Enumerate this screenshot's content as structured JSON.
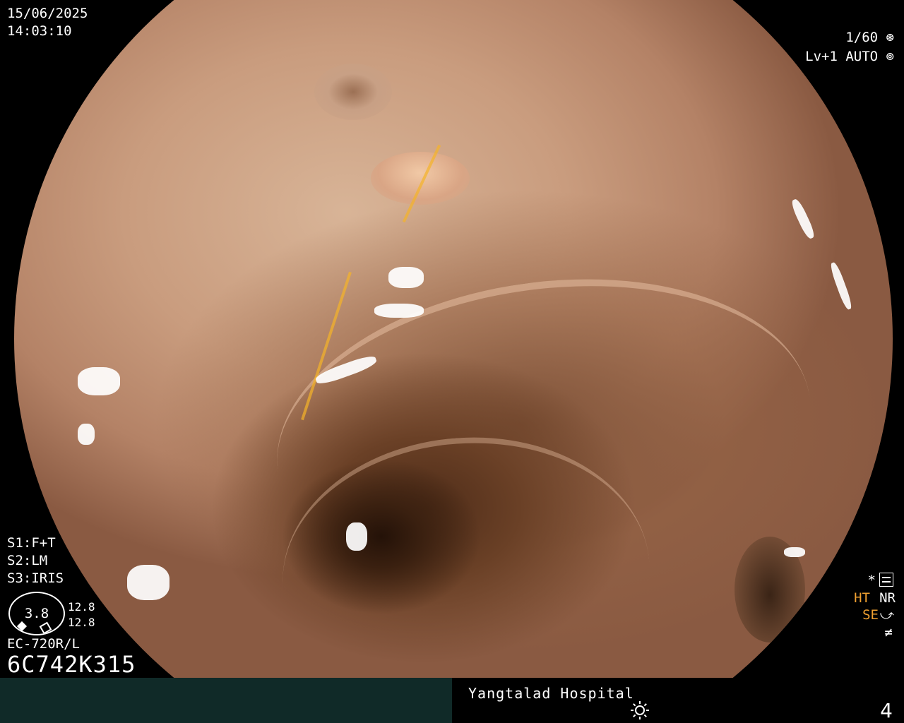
{
  "header": {
    "date": "15/06/2025",
    "time": "14:03:10"
  },
  "camera": {
    "shutter": "1/60",
    "exposure": "Lv+1 AUTO",
    "shutter_icon": "aperture-icon",
    "auto_icon": "auto-iris-icon"
  },
  "settings_list": [
    {
      "label": "S1:F+T"
    },
    {
      "label": "S2:LM"
    },
    {
      "label": "S3:IRIS"
    }
  ],
  "gauge": {
    "value": "3.8",
    "line1": "12.8",
    "line2": "12.8"
  },
  "scope": {
    "model": "EC-720R/L",
    "serial": "6C742K315"
  },
  "indicators": {
    "star": "*",
    "ht": "HT",
    "nr": "NR",
    "se": "SE",
    "se_icon": "tone-curve-icon",
    "flash_icon": "flash-off-icon",
    "settings_icon": "settings-icon"
  },
  "footer": {
    "hospital": "Yangtalad Hospital",
    "brightness_icon": "brightness-icon",
    "frame": "4"
  },
  "colors": {
    "ht": "#f0a030",
    "se": "#f0a030",
    "footer_left": "#102a28"
  }
}
